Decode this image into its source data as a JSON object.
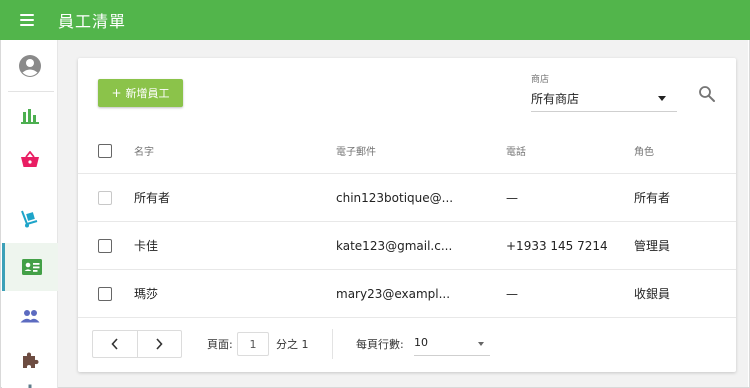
{
  "header": {
    "title": "員工清單"
  },
  "sidebar": {
    "items": [
      {
        "icon": "account-circle-icon",
        "color": "#8a8a8a"
      },
      {
        "icon": "bar-chart-icon",
        "color": "#4caf50"
      },
      {
        "icon": "shopping-basket-icon",
        "color": "#e91e63"
      },
      {
        "icon": "hand-truck-icon",
        "color": "#1ea4c9"
      },
      {
        "icon": "badge-icon",
        "color": "#43a047",
        "active": true
      },
      {
        "icon": "people-icon",
        "color": "#5c6bc0"
      },
      {
        "icon": "puzzle-icon",
        "color": "#6d4c41"
      },
      {
        "icon": "gear-icon",
        "color": "#607d8b"
      }
    ]
  },
  "toolbar": {
    "add_label": "新增員工",
    "store_label": "商店",
    "store_value": "所有商店"
  },
  "table": {
    "columns": {
      "name": "名字",
      "email": "電子郵件",
      "phone": "電話",
      "role": "角色"
    },
    "rows": [
      {
        "name": "所有者",
        "email": "chin123botique@...",
        "phone": "—",
        "role": "所有者"
      },
      {
        "name": "卡佳",
        "email": "kate123@gmail.c...",
        "phone": "+1933 145 7214",
        "role": "管理員"
      },
      {
        "name": "瑪莎",
        "email": "mary23@exampl...",
        "phone": "—",
        "role": "收銀員"
      }
    ]
  },
  "pagination": {
    "page_label": "頁面:",
    "page_value": "1",
    "of_label": "分之 1",
    "rows_label": "每頁行數:",
    "rows_value": "10"
  },
  "colors": {
    "topbar": "#52b54b",
    "add_button": "#8bc34a",
    "active_indicator": "#3ca0b8"
  }
}
